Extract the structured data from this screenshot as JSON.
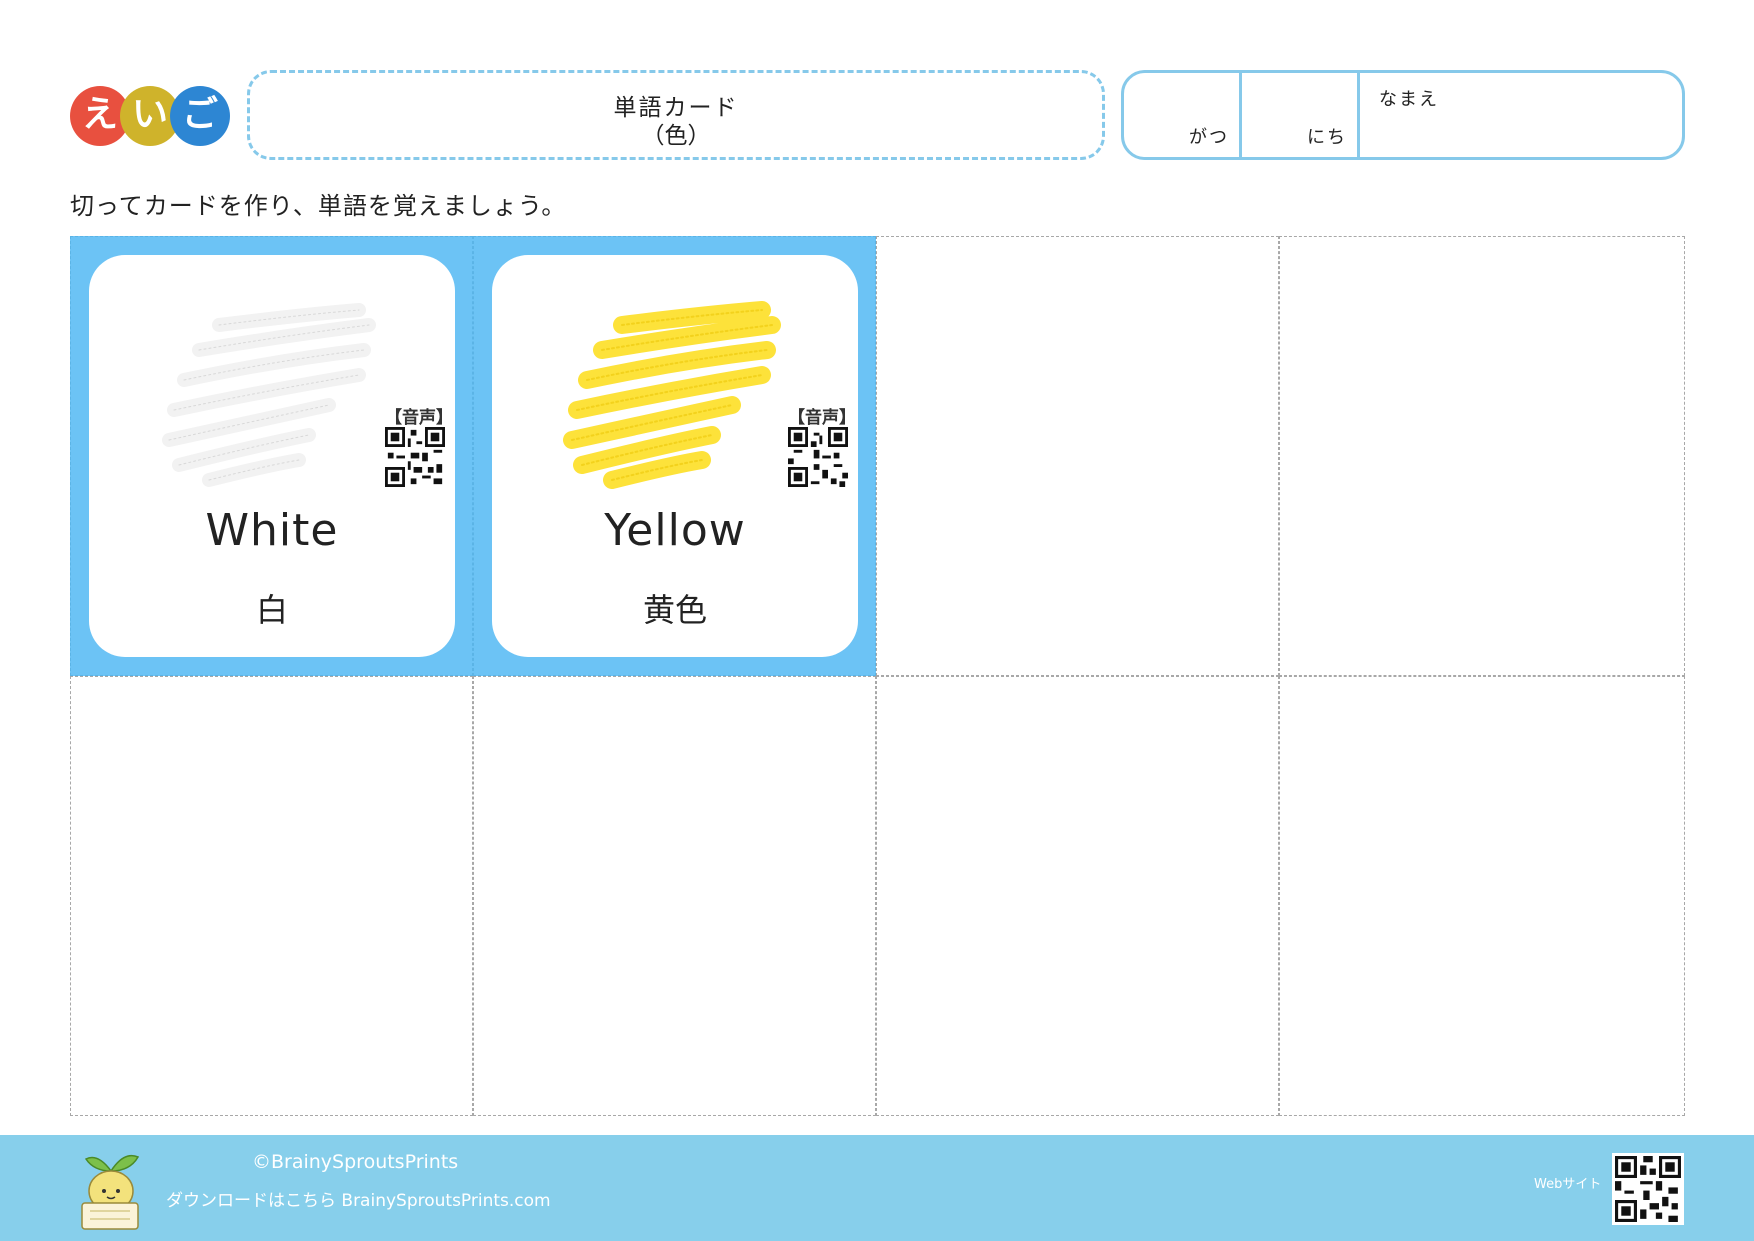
{
  "header": {
    "logo": [
      "え",
      "い",
      "ご"
    ],
    "title": "単語カード",
    "subtitle": "（色）",
    "month_label": "がつ",
    "day_label": "にち",
    "name_label": "なまえ"
  },
  "instruction": "切ってカードを作り、単語を覚えましょう。",
  "cards": [
    {
      "english": "White",
      "japanese": "白",
      "audio_label": "【音声】",
      "color": "#f2f2f2",
      "stroke": "#d8d8d8"
    },
    {
      "english": "Yellow",
      "japanese": "黄色",
      "audio_label": "【音声】",
      "color": "#fde23a",
      "stroke": "#f3d21c"
    }
  ],
  "footer": {
    "copyright": "©BrainySproutsPrints",
    "download": "ダウンロードはこちら BrainySproutsPrints.com",
    "web_label": "Webサイト"
  },
  "colors": {
    "card_bg": "#6cc3f5",
    "footer_bg": "#87cfeb",
    "border": "#86c9ea"
  }
}
